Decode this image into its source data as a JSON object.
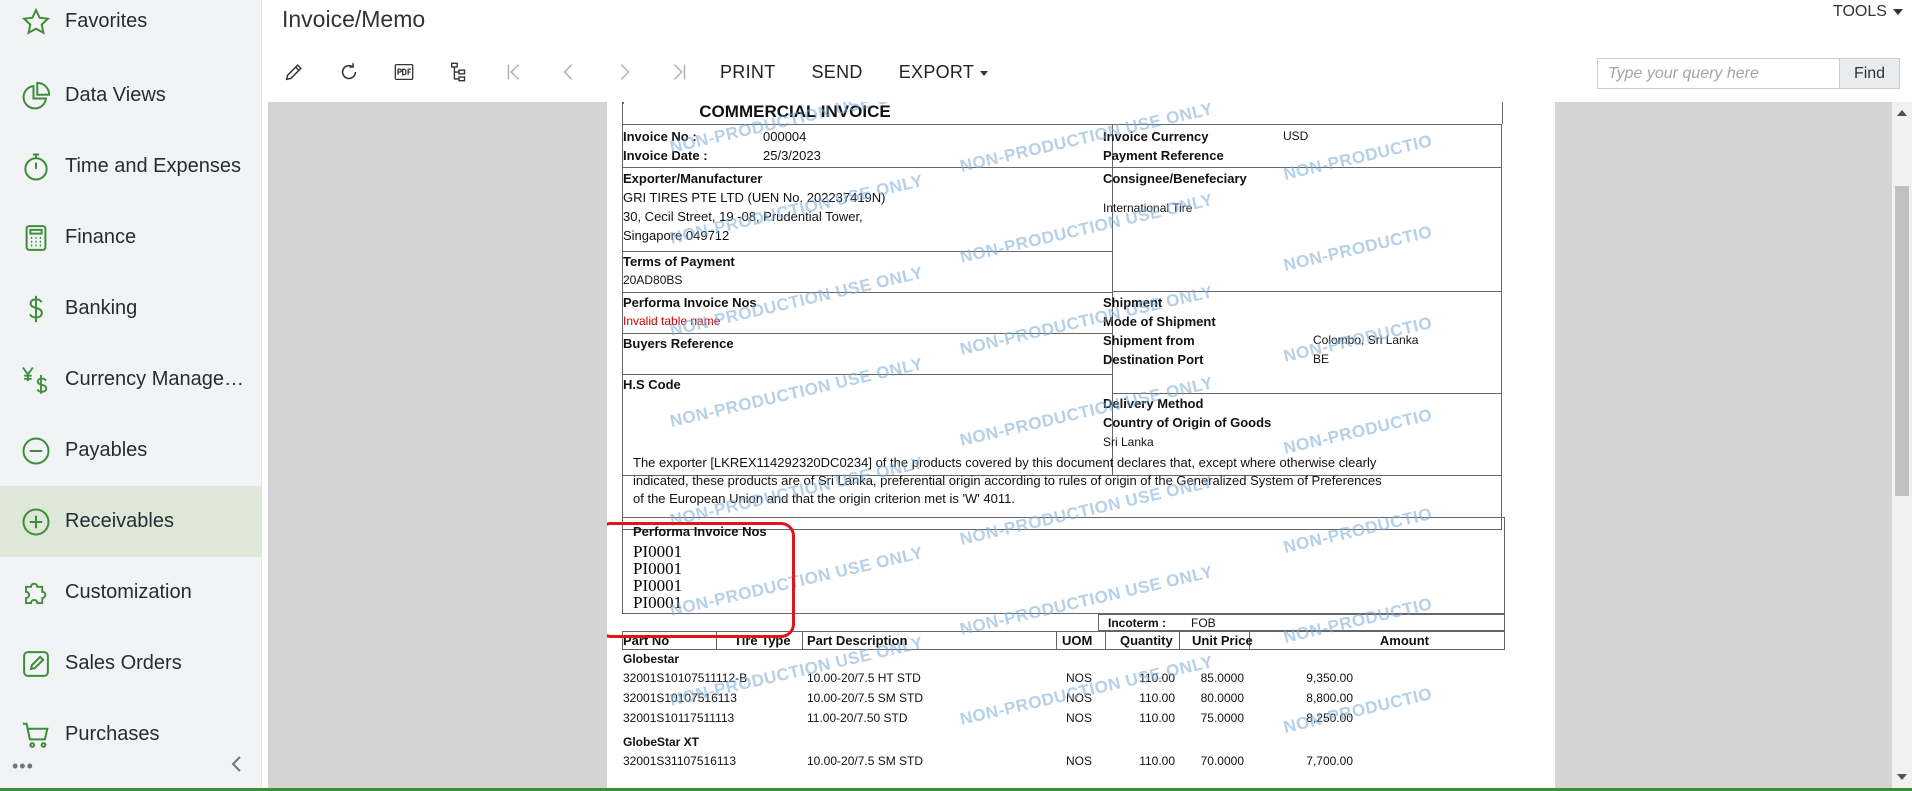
{
  "sidebar": {
    "items": [
      {
        "label": "Favorites",
        "icon": "star-icon"
      },
      {
        "label": "Data Views",
        "icon": "pie-chart-icon"
      },
      {
        "label": "Time and Expenses",
        "icon": "stopwatch-icon"
      },
      {
        "label": "Finance",
        "icon": "calculator-icon"
      },
      {
        "label": "Banking",
        "icon": "dollar-icon"
      },
      {
        "label": "Currency Management",
        "icon": "currency-icon"
      },
      {
        "label": "Payables",
        "icon": "minus-circle-icon"
      },
      {
        "label": "Receivables",
        "icon": "plus-circle-icon"
      },
      {
        "label": "Customization",
        "icon": "puzzle-icon"
      },
      {
        "label": "Sales Orders",
        "icon": "edit-box-icon"
      },
      {
        "label": "Purchases",
        "icon": "cart-icon"
      }
    ],
    "active_index": 7,
    "more_label": "•••"
  },
  "header": {
    "title": "Invoice/Memo",
    "tools_label": "TOOLS"
  },
  "toolbar": {
    "print_label": "PRINT",
    "send_label": "SEND",
    "export_label": "EXPORT"
  },
  "search": {
    "placeholder": "Type your query here",
    "value": "",
    "find_label": "Find"
  },
  "colors": {
    "accent_green": "#3f8d3a",
    "active_bg": "#dde8d8",
    "annotation_red": "#e0151b",
    "error_red": "#cc0000",
    "watermark": "#78aad7"
  },
  "invoice": {
    "title": "COMMERCIAL INVOICE",
    "invoice_no_label": "Invoice No :",
    "invoice_no": "000004",
    "invoice_date_label": "Invoice Date :",
    "invoice_date": "25/3/2023",
    "currency_label": "Invoice Currency",
    "currency": "USD",
    "payment_ref_label": "Payment Reference",
    "exporter_label": "Exporter/Manufacturer",
    "exporter_line1": "GRI TIRES PTE LTD (UEN No. 202237419N)",
    "exporter_line2": "30, Cecil Street, 19 -08, Prudential Tower,",
    "exporter_line3": "Singapore 049712",
    "consignee_label": "Consignee/Benefeciary",
    "consignee": "International Tire",
    "terms_label": "Terms of Payment",
    "terms": "20AD80BS",
    "performa_label": "Performa Invoice Nos",
    "performa_error": "Invalid table name",
    "buyers_ref_label": "Buyers Reference",
    "hs_code_label": "H.S Code",
    "shipment_label": "Shipment",
    "mode_label": "Mode of Shipment",
    "shipment_from_label": "Shipment from",
    "shipment_from": "Colombo, Sri Lanka",
    "dest_port_label": "Destination Port",
    "dest_port": "BE",
    "delivery_label": "Delivery Method",
    "origin_label": "Country of Origin of Goods",
    "origin": "Sri Lanka",
    "declaration_line1": "The exporter [LKREX114292320DC0234] of the products covered by this document declares that, except where otherwise clearly",
    "declaration_line2": "indicated, these products are of Sri Lanka, preferential origin according to rules of origin of the Generalized System of Preferences",
    "declaration_line3": "of the European Union and that the origin criterion met is 'W' 4011.",
    "pi_section_label": "Performa Invoice Nos",
    "pi_numbers": [
      "PI0001",
      "PI0001",
      "PI0001",
      "PI0001"
    ],
    "incoterm_label": "Incoterm :",
    "incoterm": "FOB",
    "watermark_text": "NON-PRODUCTION USE ONLY",
    "watermark_text_cut": "NON-PRODUCTIO",
    "columns": [
      "Part No",
      "Tire Type",
      "Part Description",
      "UOM",
      "Quantity",
      "Unit Price",
      "Amount"
    ],
    "groups": [
      {
        "name": "Globestar",
        "rows": [
          {
            "part_no": "32001S10107511112-B",
            "desc": "10.00-20/7.5 HT STD",
            "uom": "NOS",
            "qty": "110.00",
            "price": "85.0000",
            "amount": "9,350.00"
          },
          {
            "part_no": "32001S10107516113",
            "desc": "10.00-20/7.5 SM STD",
            "uom": "NOS",
            "qty": "110.00",
            "price": "80.0000",
            "amount": "8,800.00"
          },
          {
            "part_no": "32001S10117511113",
            "desc": "11.00-20/7.50 STD",
            "uom": "NOS",
            "qty": "110.00",
            "price": "75.0000",
            "amount": "8,250.00"
          }
        ]
      },
      {
        "name": "GlobeStar XT",
        "rows": [
          {
            "part_no": "32001S31107516113",
            "desc": "10.00-20/7.5 SM STD",
            "uom": "NOS",
            "qty": "110.00",
            "price": "70.0000",
            "amount": "7,700.00"
          }
        ]
      }
    ]
  }
}
